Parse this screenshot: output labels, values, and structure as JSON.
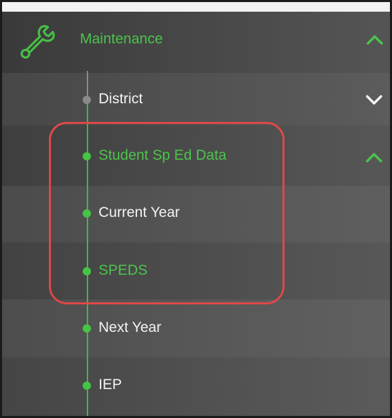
{
  "menu": {
    "header": {
      "label": "Maintenance",
      "icon": "wrench-icon",
      "state": "expanded"
    },
    "items": [
      {
        "label": "District",
        "color": "white",
        "dot": "gray",
        "toggle": "collapsed"
      },
      {
        "label": "Student Sp Ed Data",
        "color": "green",
        "dot": "green",
        "toggle": "expanded"
      },
      {
        "label": "Current Year",
        "color": "white",
        "dot": "green"
      },
      {
        "label": "SPEDS",
        "color": "green",
        "dot": "green"
      },
      {
        "label": "Next Year",
        "color": "white",
        "dot": "green"
      },
      {
        "label": "IEP",
        "color": "white",
        "dot": "green"
      }
    ]
  },
  "colors": {
    "accent_green": "#4cc34c",
    "text_white": "#f4f4f4",
    "inactive_gray": "#8a8a8a",
    "highlight_red": "#e04848"
  }
}
